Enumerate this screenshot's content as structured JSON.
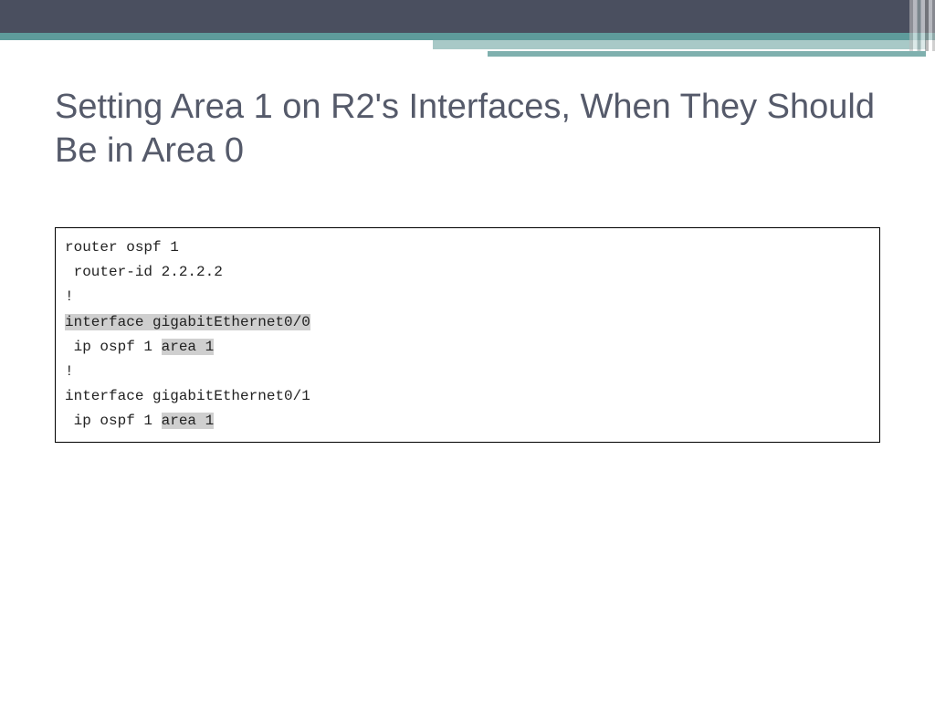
{
  "title": "Setting Area 1 on R2's Interfaces, When They Should Be in Area 0",
  "code": {
    "l1": "router ospf 1",
    "l2": " router-id 2.2.2.2",
    "l3": "!",
    "l4_hl": "interface gigabitEthernet0/0",
    "l5_pre": " ip ospf 1 ",
    "l5_hl": "area 1",
    "l6": "!",
    "l7": "interface gigabitEthernet0/1",
    "l8_pre": " ip ospf 1 ",
    "l8_hl": "area 1"
  }
}
